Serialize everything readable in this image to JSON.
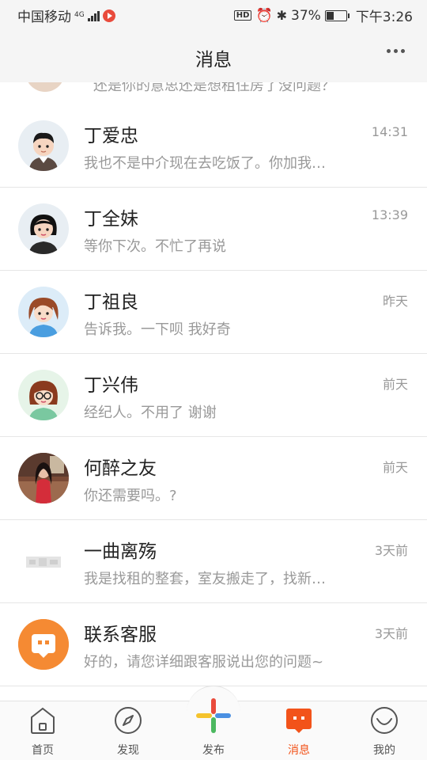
{
  "status_bar": {
    "carrier": "中国移动",
    "network": "4G",
    "hd": "HD",
    "battery": "37%",
    "time": "下午3:26"
  },
  "header": {
    "title": "消息"
  },
  "partial_row": {
    "preview": "还是你的意思还是想租住房了没问题？"
  },
  "conversations": [
    {
      "name": "丁爱忠",
      "time": "14:31",
      "preview": "我也不是中介现在去吃饭了。你加我…"
    },
    {
      "name": "丁全妹",
      "time": "13:39",
      "preview": "等你下次。不忙了再说"
    },
    {
      "name": "丁祖良",
      "time": "昨天",
      "preview": "告诉我。一下呗 我好奇"
    },
    {
      "name": "丁兴伟",
      "time": "前天",
      "preview": "经纪人。不用了 谢谢"
    },
    {
      "name": "何醉之友",
      "time": "前天",
      "preview": "你还需要吗。?"
    },
    {
      "name": "一曲离殇",
      "time": "3天前",
      "preview": "我是找租的整套，室友搬走了，找新…"
    },
    {
      "name": "联系客服",
      "time": "3天前",
      "preview": "好的，请您详细跟客服说出您的问题~"
    }
  ],
  "tabbar": {
    "home": "首页",
    "discover": "发现",
    "publish": "发布",
    "messages": "消息",
    "mine": "我的"
  },
  "colors": {
    "accent": "#f2531a",
    "service_avatar": "#f58a33"
  }
}
